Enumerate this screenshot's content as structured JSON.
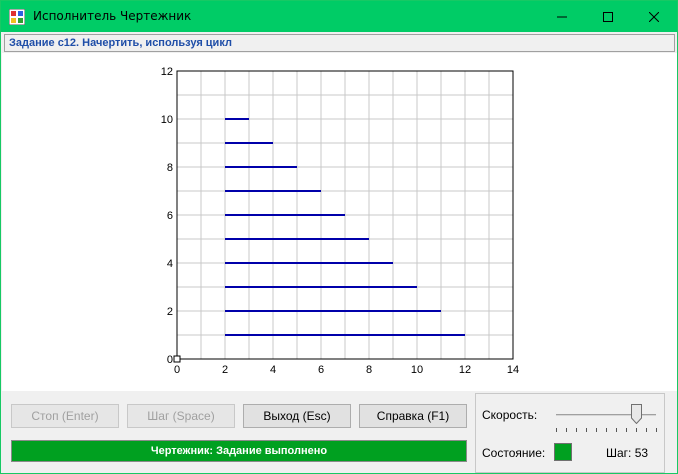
{
  "window": {
    "title": "Исполнитель Чертежник"
  },
  "task": {
    "text": "Задание с12. Начертить, используя цикл"
  },
  "buttons": {
    "stop": "Стоп (Enter)",
    "step": "Шаг (Space)",
    "exit": "Выход (Esc)",
    "help": "Справка (F1)"
  },
  "status": {
    "message": "Чертежник: Задание выполнено",
    "speed_label": "Скорость:",
    "state_label": "Состояние:",
    "step_label": "Шаг: 53",
    "state_color": "#00a020",
    "speed_fraction": 0.8
  },
  "colors": {
    "titlebar": "#00cc66",
    "line": "#0000aa",
    "grid": "#c8c8c8"
  },
  "chart_data": {
    "type": "line",
    "xlim": [
      0,
      14
    ],
    "ylim": [
      0,
      12
    ],
    "xticks": [
      "0",
      "2",
      "4",
      "6",
      "8",
      "10",
      "12",
      "14"
    ],
    "yticks": [
      "0",
      "2",
      "4",
      "6",
      "8",
      "10",
      "12"
    ],
    "grid": true,
    "segments": [
      {
        "x1": 2,
        "x2": 12,
        "y": 1
      },
      {
        "x1": 2,
        "x2": 11,
        "y": 2
      },
      {
        "x1": 2,
        "x2": 10,
        "y": 3
      },
      {
        "x1": 2,
        "x2": 9,
        "y": 4
      },
      {
        "x1": 2,
        "x2": 8,
        "y": 5
      },
      {
        "x1": 2,
        "x2": 7,
        "y": 6
      },
      {
        "x1": 2,
        "x2": 6,
        "y": 7
      },
      {
        "x1": 2,
        "x2": 5,
        "y": 8
      },
      {
        "x1": 2,
        "x2": 4,
        "y": 9
      },
      {
        "x1": 2,
        "x2": 3,
        "y": 10
      }
    ],
    "pen_position": [
      0,
      0
    ]
  }
}
